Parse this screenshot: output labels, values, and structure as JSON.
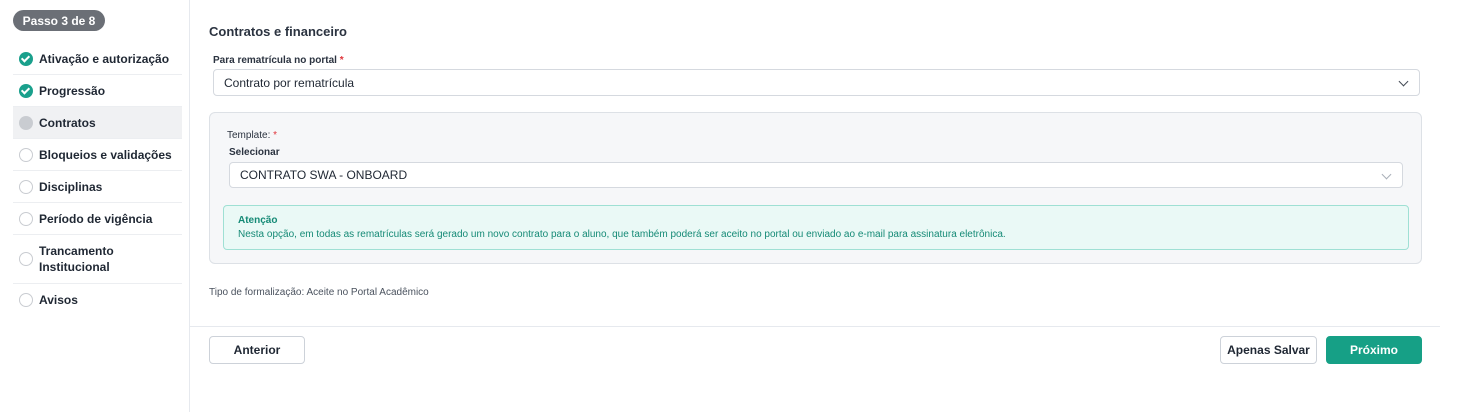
{
  "sidebar": {
    "step_badge": "Passo 3 de 8",
    "items": [
      {
        "label": "Ativação e autorização",
        "status": "done"
      },
      {
        "label": "Progressão",
        "status": "done"
      },
      {
        "label": "Contratos",
        "status": "current"
      },
      {
        "label": "Bloqueios e validações",
        "status": "todo"
      },
      {
        "label": "Disciplinas",
        "status": "todo"
      },
      {
        "label": "Período de vigência",
        "status": "todo"
      },
      {
        "label": "Trancamento Institucional",
        "status": "todo"
      },
      {
        "label": "Avisos",
        "status": "todo"
      }
    ]
  },
  "main": {
    "section_title": "Contratos e financeiro",
    "portal_field": {
      "label": "Para rematrícula no portal",
      "required_mark": "*",
      "value": "Contrato por rematrícula"
    },
    "template": {
      "label": "Template:",
      "required_mark": "*",
      "sublabel": "Selecionar",
      "value": "CONTRATO SWA - ONBOARD"
    },
    "alert": {
      "title": "Atenção",
      "text": "Nesta opção, em todas as rematrículas será gerado um novo contrato para o aluno, que também poderá ser aceito no portal ou enviado ao e-mail para assinatura eletrônica."
    },
    "formalization": "Tipo de formalização: Aceite no Portal Acadêmico"
  },
  "footer": {
    "previous_label": "Anterior",
    "save_label": "Apenas Salvar",
    "next_label": "Próximo"
  },
  "colors": {
    "accent": "#16a086",
    "required": "#e0353b",
    "alert_bg": "#eaf9f6"
  }
}
